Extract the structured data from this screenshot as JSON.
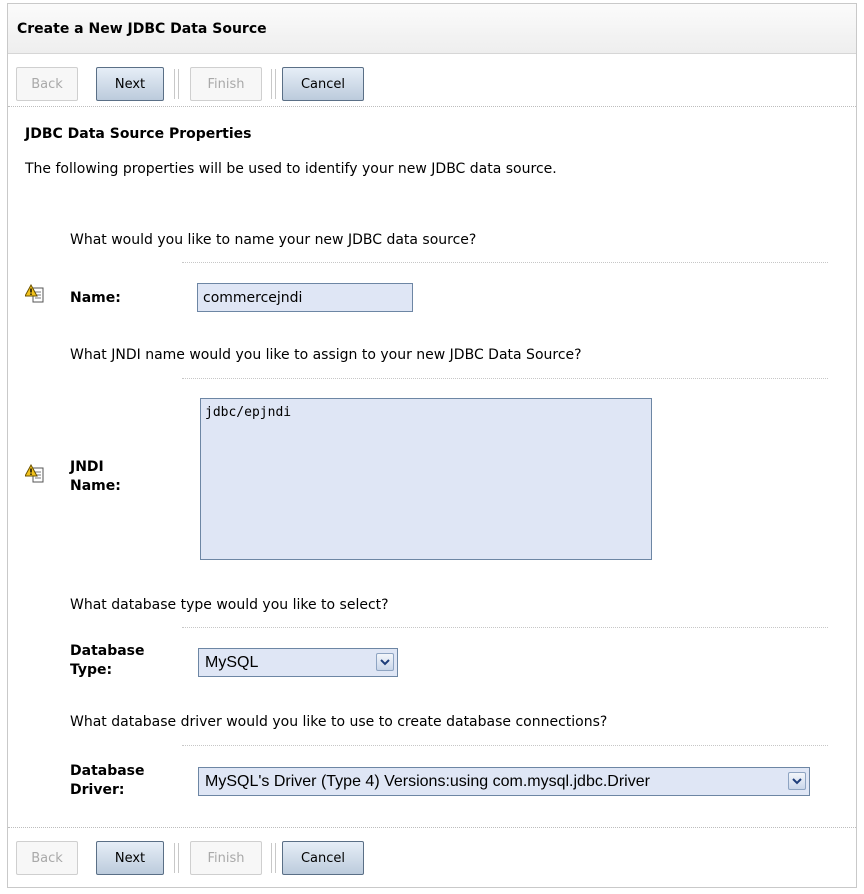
{
  "panel": {
    "title": "Create a New JDBC Data Source"
  },
  "toolbar": {
    "back_label": "Back",
    "next_label": "Next",
    "finish_label": "Finish",
    "cancel_label": "Cancel"
  },
  "section": {
    "title": "JDBC Data Source Properties",
    "description": "The following properties will be used to identify your new JDBC data source."
  },
  "fields": {
    "name": {
      "question": "What would you like to name your new JDBC data source?",
      "label": "Name:",
      "value": "commercejndi",
      "icon": "required-field-warning-icon"
    },
    "jndi": {
      "question": "What JNDI name would you like to assign to your new JDBC Data Source?",
      "label_line1": "JNDI",
      "label_line2": "Name:",
      "value": "jdbc/epjndi",
      "icon": "required-field-warning-icon"
    },
    "db_type": {
      "question": "What database type would you like to select?",
      "label_line1": "Database",
      "label_line2": "Type:",
      "value": "MySQL"
    },
    "db_driver": {
      "question": "What database driver would you like to use to create database connections?",
      "label_line1": "Database",
      "label_line2": "Driver:",
      "value": "MySQL's Driver (Type 4) Versions:using com.mysql.jdbc.Driver"
    }
  },
  "colors": {
    "field_bg": "#dfe6f5",
    "field_border": "#6d86a4",
    "button_enabled": "#bccbdc"
  }
}
